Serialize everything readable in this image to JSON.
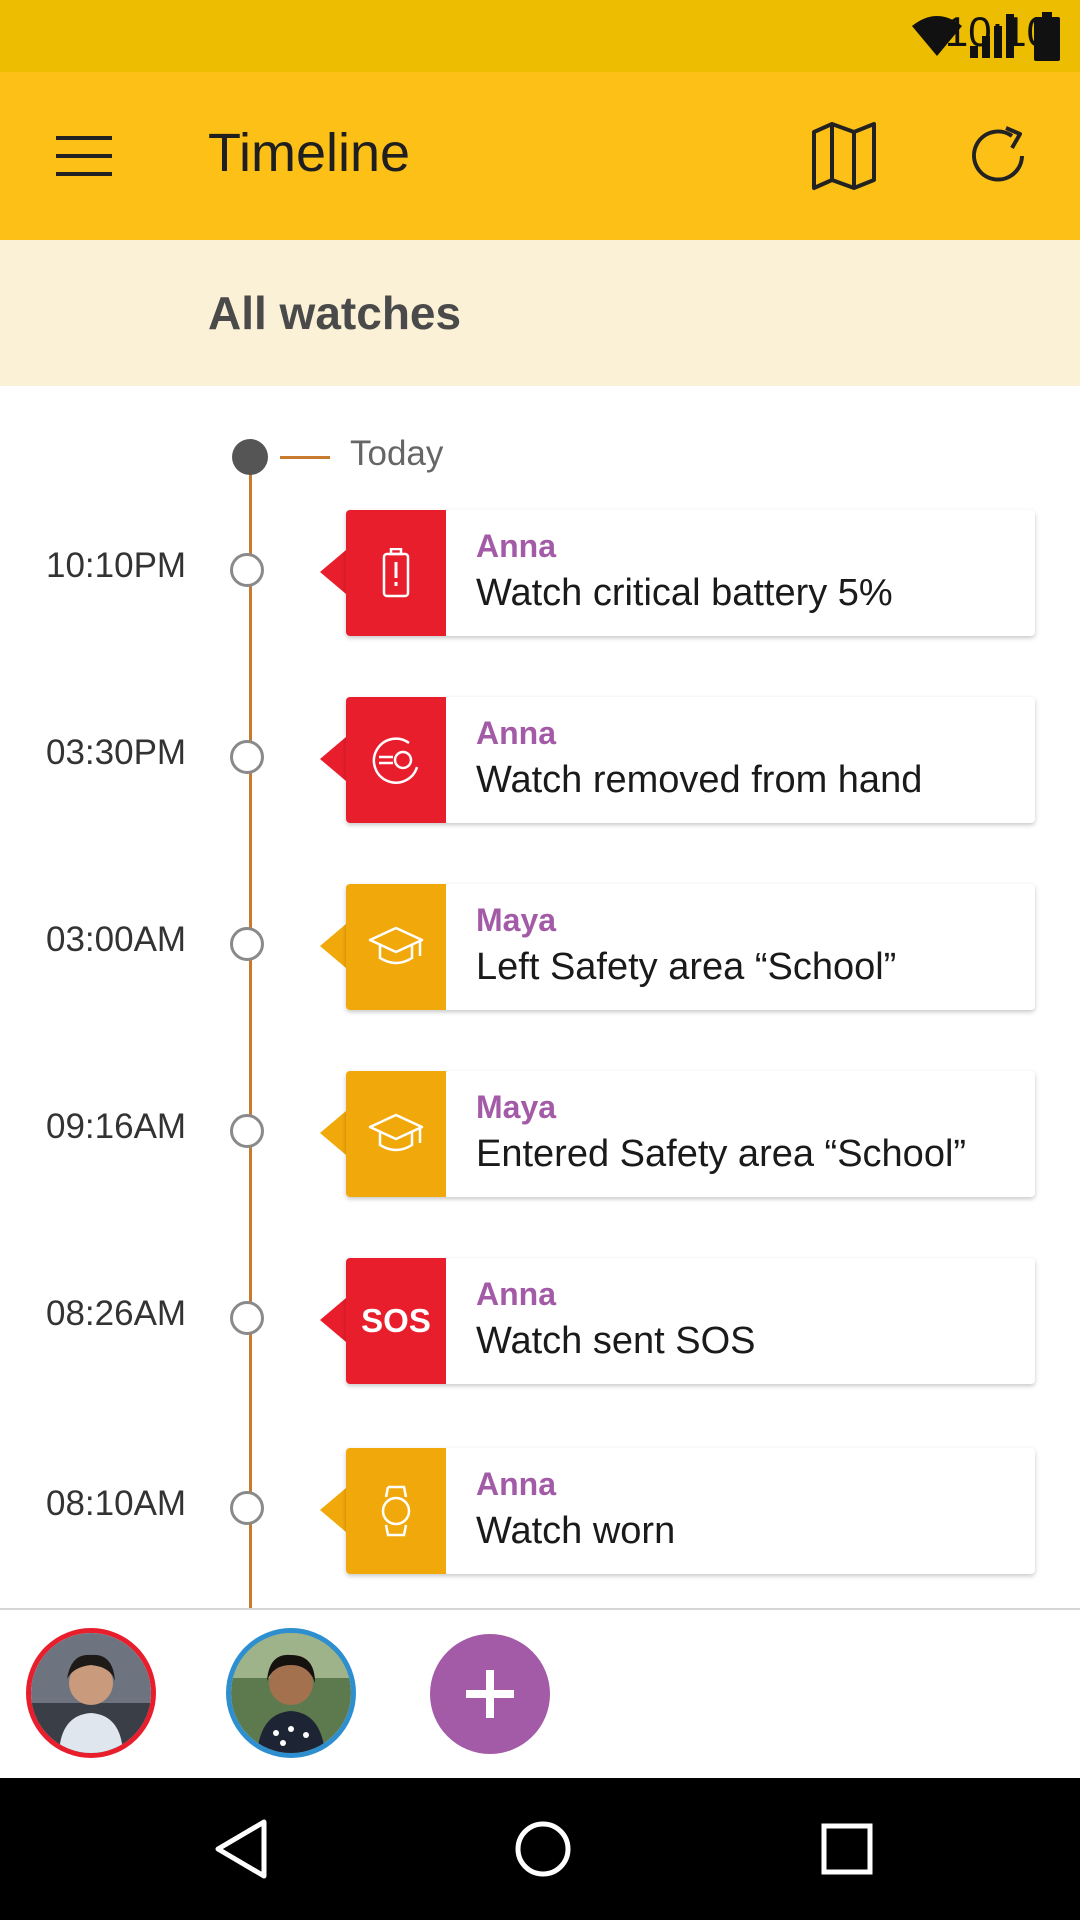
{
  "status_bar": {
    "time": "10:10"
  },
  "app_bar": {
    "title": "Timeline"
  },
  "filter": {
    "label": "All watches"
  },
  "timeline": {
    "today_label": "Today",
    "events": [
      {
        "time": "10:10PM",
        "name": "Anna",
        "text": "Watch critical battery 5%",
        "icon": "battery-alert-icon",
        "color": "#E91E2C"
      },
      {
        "time": "03:30PM",
        "name": "Anna",
        "text": "Watch removed from hand",
        "icon": "watch-removed-icon",
        "color": "#E91E2C"
      },
      {
        "time": "03:00AM",
        "name": "Maya",
        "text": "Left Safety area “School”",
        "icon": "graduation-cap-icon",
        "color": "#F1A80A"
      },
      {
        "time": "09:16AM",
        "name": "Maya",
        "text": "Entered Safety area “School”",
        "icon": "graduation-cap-icon",
        "color": "#F1A80A"
      },
      {
        "time": "08:26AM",
        "name": "Anna",
        "text": "Watch sent SOS",
        "icon": "sos-icon",
        "icon_text": "SOS",
        "color": "#E91E2C"
      },
      {
        "time": "08:10AM",
        "name": "Anna",
        "text": "Watch worn",
        "icon": "watch-icon",
        "color": "#F1A80A"
      }
    ]
  },
  "contacts": {
    "avatars": [
      {
        "icon": "avatar-photo",
        "ring_color": "#E91E2C"
      },
      {
        "icon": "avatar-photo",
        "ring_color": "#2E8FD0"
      }
    ],
    "add_icon": "plus-icon"
  },
  "colors": {
    "status_bar": "#EDBD02",
    "app_bar": "#FDC017",
    "filter_bar": "#FBF1D6",
    "accent_purple": "#A35BA8",
    "timeline_line": "#C87A2F"
  }
}
